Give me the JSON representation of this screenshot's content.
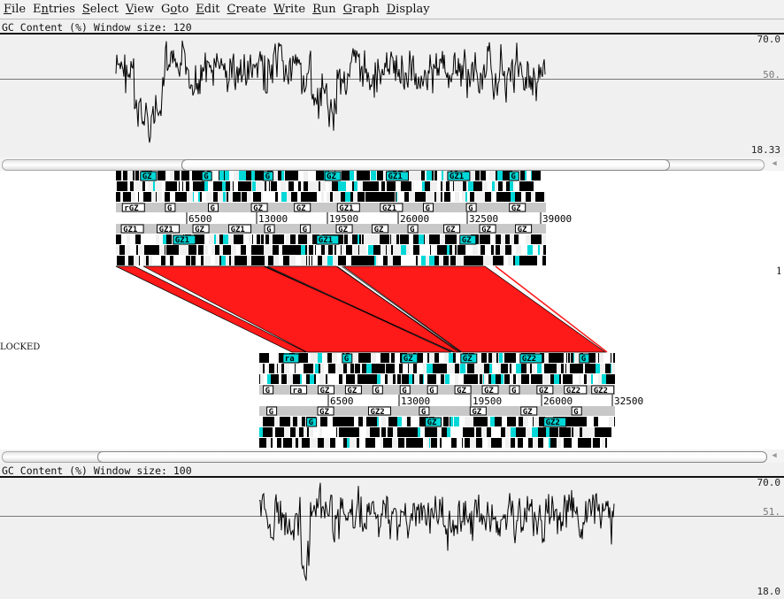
{
  "menubar": {
    "items": [
      {
        "label": "File",
        "mnemonic": "F"
      },
      {
        "label": "Entries",
        "mnemonic": "n"
      },
      {
        "label": "Select",
        "mnemonic": "S"
      },
      {
        "label": "View",
        "mnemonic": "V"
      },
      {
        "label": "Goto",
        "mnemonic": "o"
      },
      {
        "label": "Edit",
        "mnemonic": "E"
      },
      {
        "label": "Create",
        "mnemonic": "C"
      },
      {
        "label": "Write",
        "mnemonic": "W"
      },
      {
        "label": "Run",
        "mnemonic": "R"
      },
      {
        "label": "Graph",
        "mnemonic": "G"
      },
      {
        "label": "Display",
        "mnemonic": "D"
      }
    ]
  },
  "top_graph": {
    "title": "GC Content (%)  Window size: 120",
    "max_label": "70.0",
    "mid_label": "50.",
    "min_label": "18.33"
  },
  "top_sequence": {
    "ticks": [
      "6500",
      "13000",
      "19500",
      "26000",
      "32500",
      "39000"
    ],
    "feature_labels_forward": [
      "rGZ",
      "G",
      "G",
      "GZ",
      "GZ",
      "GZ1",
      "GZ1",
      "G",
      "G",
      "GZ"
    ],
    "feature_labels_reverse": [
      "GZ1",
      "GZ1",
      "GZ",
      "GZ1",
      "G",
      "G",
      "GZ",
      "GZ",
      "G",
      "GZ",
      "GZ",
      "GZ"
    ]
  },
  "comparison": {
    "locked_label": "LOCKED",
    "side_label": "1",
    "match_color": "#ff1a1a"
  },
  "bottom_sequence": {
    "ticks": [
      "6500",
      "13000",
      "19500",
      "26000",
      "32500"
    ],
    "feature_labels_forward": [
      "G",
      "ra",
      "GZ",
      "GZ",
      "G",
      "G",
      "G",
      "GZ",
      "GZ",
      "G",
      "GZ",
      "GZ2",
      "GZ2"
    ],
    "feature_labels_reverse": [
      "G",
      "GZ",
      "GZ2",
      "G",
      "GZ",
      "GZ",
      "G"
    ]
  },
  "bottom_graph": {
    "title": "GC Content (%)  Window size: 100",
    "max_label": "70.0",
    "mid_label": "51.",
    "min_label": "18.0"
  }
}
